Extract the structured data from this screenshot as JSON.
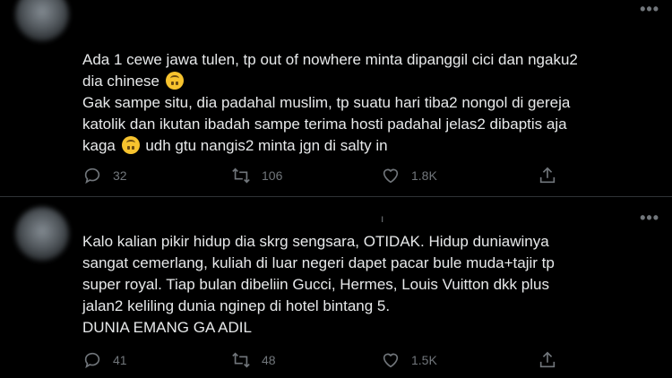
{
  "tweets": [
    {
      "lines": [
        "Ada 1 cewe jawa tulen, tp out of nowhere minta dipanggil cici dan ngaku2",
        "dia chinese",
        "Gak sampe situ, dia padahal muslim, tp suatu hari tiba2 nongol di gereja",
        "katolik dan ikutan ibadah sampe terima hosti padahal jelas2 dibaptis aja",
        "kaga",
        "udh gtu nangis2 minta jgn di salty in"
      ],
      "replies": "32",
      "retweets": "106",
      "likes": "1.8K"
    },
    {
      "lines": [
        "Kalo kalian pikir hidup dia skrg sengsara, OTIDAK. Hidup duniawinya",
        "sangat cemerlang, kuliah di luar negeri dapet pacar bule muda+tajir tp",
        "super royal. Tiap bulan dibeliin Gucci, Hermes, Louis Vuitton dkk plus",
        "jalan2 keliling dunia nginep di hotel bintang 5.",
        "DUNIA EMANG GA ADIL"
      ],
      "replies": "41",
      "retweets": "48",
      "likes": "1.5K"
    }
  ],
  "more_glyph": "•••",
  "stray_mark": "ı",
  "icons": {
    "reply": "reply-icon",
    "retweet": "retweet-icon",
    "like": "like-icon",
    "share": "share-icon",
    "emoji": "upside-down-face-emoji"
  },
  "colors": {
    "background": "#000000",
    "text": "#e7e9ea",
    "muted": "#71767b",
    "divider": "#2f3336"
  }
}
